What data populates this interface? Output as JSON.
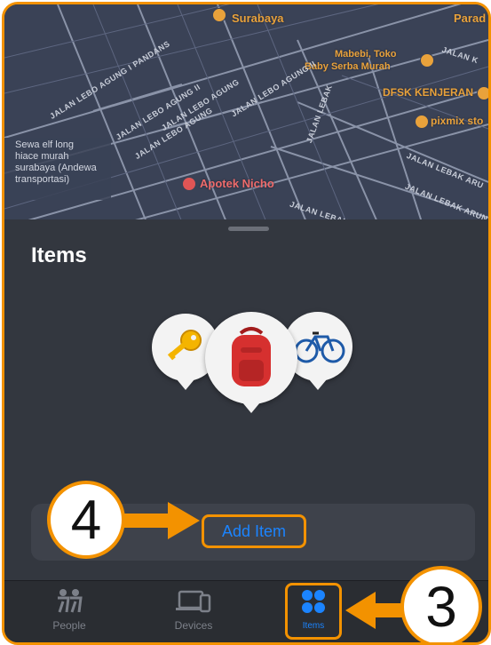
{
  "map": {
    "labels": [
      "Surabaya",
      "Parad",
      "Mabebi, Toko",
      "Baby Serba Murah",
      "DFSK KENJERAN",
      "pixmix sto",
      "Apotek Nicho"
    ],
    "streets": [
      "JALAN LEBO AGUNG I PANDANS",
      "JALAN LEBO AGUNG II",
      "JALAN LEBO AGUNG",
      "JALAN LEBO AGUNG II",
      "JALAN LEBO AGUNG",
      "JALAN LEBAK",
      "JALAN LEBAK ARU",
      "JALAN LEBAK ARUN",
      "JALAN LEBAK",
      "JALAN K"
    ],
    "business_lines": [
      "Sewa elf long",
      "hiace murah",
      "surabaya (Andewa",
      "transportasi)"
    ]
  },
  "sheet": {
    "title": "Items",
    "add_item_label": "Add Item"
  },
  "item_icons": [
    "key-icon",
    "backpack-icon",
    "bicycle-icon"
  ],
  "tabs": [
    {
      "label": "People",
      "icon": "people-icon"
    },
    {
      "label": "Devices",
      "icon": "devices-icon"
    },
    {
      "label": "Items",
      "icon": "items-icon",
      "selected": true
    }
  ],
  "callouts": {
    "step_4": "4",
    "step_3": "3"
  },
  "colors": {
    "highlight": "#f39200",
    "accent_blue": "#1b84ff",
    "sheet_bg": "#33373f",
    "map_bg": "#3a4256"
  }
}
